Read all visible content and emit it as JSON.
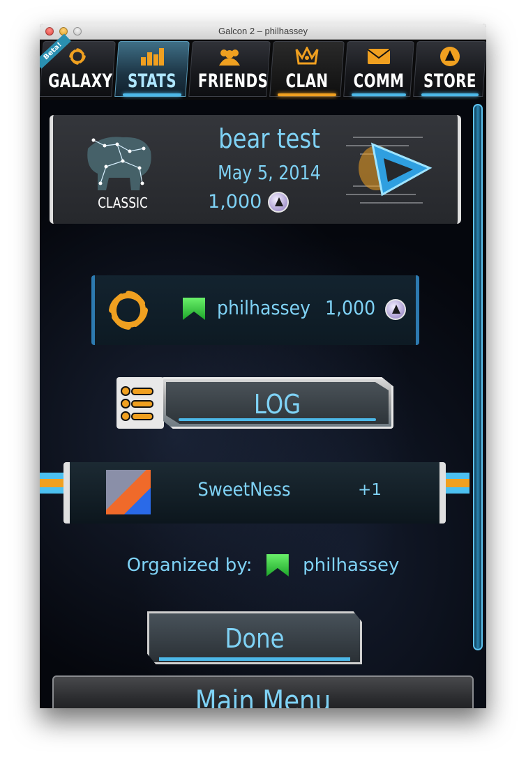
{
  "window": {
    "title": "Galcon 2 – philhassey"
  },
  "tabs": [
    {
      "label": "GALAXY",
      "icon": "galaxy-swirl-icon",
      "badge": "Beta!"
    },
    {
      "label": "STATS",
      "icon": "bar-chart-icon",
      "active": true
    },
    {
      "label": "FRIENDS",
      "icon": "people-icon"
    },
    {
      "label": "CLAN",
      "icon": "crown-icon"
    },
    {
      "label": "COMM",
      "icon": "envelope-icon"
    },
    {
      "label": "STORE",
      "icon": "coin-icon"
    }
  ],
  "game": {
    "title": "bear test",
    "date": "May 5, 2014",
    "cost": "1,000",
    "mode": "CLASSIC",
    "map_icon": "bear-constellation-icon",
    "play_icon": "play-arrow-icon"
  },
  "player": {
    "name": "philhassey",
    "score": "1,000",
    "icon": "galaxy-swirl-icon"
  },
  "log": {
    "label": "LOG",
    "icon": "numbered-list-icon"
  },
  "team": {
    "name": "SweetNess",
    "score": "+1",
    "logo": "team-logo-icon"
  },
  "organized": {
    "prefix": "Organized by:",
    "name": "philhassey"
  },
  "buttons": {
    "done": "Done",
    "main_menu": "Main Menu"
  },
  "colors": {
    "accent": "#7fd2f5",
    "orange": "#f0a020",
    "panel_blue": "#2d7ab0"
  }
}
